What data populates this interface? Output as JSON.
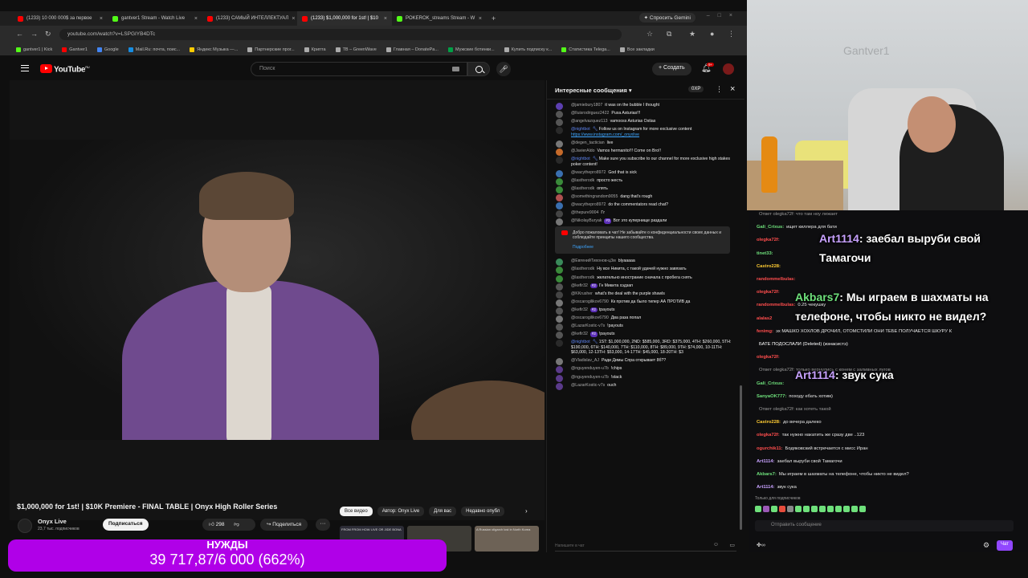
{
  "browser": {
    "tabs": [
      {
        "label": "(1233) 10 000 000$ за первое",
        "color": "#ff0000"
      },
      {
        "label": "gantver1 Stream - Watch Live",
        "color": "#53fc18"
      },
      {
        "label": "(1233) САМЫЙ ИНТЕЛЛЕКТУАЛ",
        "color": "#ff0000"
      },
      {
        "label": "(1233) $1,000,000 for 1st! | $10",
        "color": "#ff0000"
      },
      {
        "label": "POKEROK_streams Stream - W",
        "color": "#53fc18"
      }
    ],
    "gemini_label": "Спросить Gemini",
    "address": "youtube.com/watch?v=LSPGIYB4DTc",
    "bookmarks": [
      {
        "label": "gantver1 | Kick",
        "color": "#53fc18"
      },
      {
        "label": "Gantver1",
        "color": "#ff0000"
      },
      {
        "label": "Google",
        "color": "#4285f4"
      },
      {
        "label": "Mail.Ru: почта, поис...",
        "color": "#168de2"
      },
      {
        "label": "Яндекс Музыка —...",
        "color": "#ffcc00"
      },
      {
        "label": "Партнерские прог...",
        "color": "#aaaaaa"
      },
      {
        "label": "Крипта",
        "color": "#aaaaaa"
      },
      {
        "label": "TB – GreenWave",
        "color": "#aaaaaa"
      },
      {
        "label": "Главная – DonatePa...",
        "color": "#aaaaaa"
      },
      {
        "label": "Мужские ботинки...",
        "color": "#00a046"
      },
      {
        "label": "Купить подписку к...",
        "color": "#aaaaaa"
      },
      {
        "label": "Статистика Теlega...",
        "color": "#53fc18"
      },
      {
        "label": "Все закладки",
        "color": "#aaaaaa"
      }
    ]
  },
  "youtube": {
    "logo_text": "YouTube",
    "logo_region": "RU",
    "search_placeholder": "Поиск",
    "create_label": "+ Создать",
    "notifications_badge": "9+",
    "video_title": "$1,000,000 for 1st! | $10K Premiere - FINAL TABLE | Onyx High Roller Series",
    "channel_name": "Onyx Live",
    "channel_subs": "23,7 тыс. подписчиков",
    "subscribe_label": "Подписаться",
    "likes": "298",
    "share_label": "Поделиться",
    "chips": [
      "Все видео",
      "Автор: Onyx Live",
      "Для вас",
      "Недавно опубл"
    ],
    "thumb_captions": [
      "FROM FROM HOW LIVE OR JIDE BONA",
      "",
      "A Russian oligarch lost in North Korea"
    ]
  },
  "chat": {
    "header_title": "Интересные сообщения",
    "xp_label": "0XP",
    "input_placeholder": "Напишите в чат",
    "notice_text": "Добро пожаловать в чат! Не забывайте о конфиденциальности своих данных и соблюдайте принципы нашего сообщества.",
    "notice_more": "Подробнее",
    "messages": [
      {
        "author": "@jamiebury1807",
        "text": "it was on the bubble I thought",
        "color": "#5c3fb0"
      },
      {
        "author": "@lluisrodriguez2422",
        "text": "Puxa Asturias!!!",
        "color": "#555555"
      },
      {
        "author": "@angelvazquez113",
        "text": "vamooss Asturias Ostias",
        "color": "#555555"
      },
      {
        "author": "@nightbot",
        "text": "Follow us on Instagram for more exclusive content",
        "link": "https://www.instagram.com/_onyxlive",
        "mod": true,
        "color": "#2a2a2a"
      },
      {
        "author": "@degen_tactician",
        "text": "live",
        "color": "#777777"
      },
      {
        "author": "@JavierAldo",
        "text": "Vamos hermanito!!! Come on Bro!!",
        "color": "#c56a2a"
      },
      {
        "author": "@nightbot",
        "text": "Make sure you subscribe to our channel for more exclusive high stakes poker content!",
        "mod": true,
        "color": "#2a2a2a"
      },
      {
        "author": "@wacythepro8972",
        "text": "God that is sick",
        "color": "#3a6fb0"
      },
      {
        "author": "@lastherodk",
        "text": "просто жесть",
        "color": "#3a8a3a"
      },
      {
        "author": "@lastherodk",
        "text": "опять",
        "color": "#3a8a3a"
      },
      {
        "author": "@somethingrandom9055",
        "text": "dang that's rough",
        "color": "#b05050"
      },
      {
        "author": "@wacythepro8972",
        "text": "do the commentators read chat?",
        "color": "#3a6fb0"
      },
      {
        "author": "@thepure9004",
        "text": "Гг",
        "color": "#444444"
      },
      {
        "author": "@NikolayBuryak",
        "badge": "#3",
        "text": "Вот это купернище раздали",
        "color": "#777777"
      }
    ],
    "messages2": [
      {
        "author": "@ЕвгенийТихонов-ц3м",
        "text": "blyaaaaa",
        "color": "#3a8a5a"
      },
      {
        "author": "@lastherodk",
        "text": "Ну все Никита, с такой удачей нужно завязать",
        "color": "#3a8a3a"
      },
      {
        "author": "@lastherodk",
        "text": "желательно инострание сначала с пробега снять",
        "color": "#3a8a3a"
      },
      {
        "author": "@kefir32",
        "badge": "#2",
        "text": "Гн Микита хэдзап",
        "color": "#555555"
      },
      {
        "author": "@KKrusher",
        "text": "what's the deal with the purple shawls",
        "color": "#444444"
      },
      {
        "author": "@oscarogilikov6790",
        "text": "Кк против да было типер АА ПРОТИВ да",
        "color": "#777777"
      },
      {
        "author": "@kefir32",
        "badge": "#2",
        "text": "tpayouts",
        "color": "#555555"
      },
      {
        "author": "@oscarogilikov6790",
        "text": "Два раза попал",
        "color": "#777777"
      },
      {
        "author": "@LazarKostic-v7s",
        "text": "!payouts",
        "color": "#555555"
      },
      {
        "author": "@kefir32",
        "badge": "#2",
        "text": "!payouts",
        "color": "#555555"
      },
      {
        "author": "@nightbot",
        "text": "1ST: $1,000,000, 2ND: $585,000, 3RD: $375,000, 4TH: $260,000, 5TH: $190,000, 6TH: $140,000, 7TH: $110,000, 8TH: $89,000, 9TH: $74,000, 10-11TH: $63,000, 12-13TH: $53,000, 14-17TH: $45,000, 18-20TH: $3",
        "mod": true,
        "color": "#2a2a2a"
      },
      {
        "author": "@Vladislav_AJ",
        "text": "Ради Димы Спра открывает 8б??",
        "color": "#777777"
      },
      {
        "author": "@nguyenduyen-u7b",
        "text": "!chips",
        "color": "#5a3a8a"
      },
      {
        "author": "@nguyenduyen-u7b",
        "text": "!stack",
        "color": "#5a3a8a"
      },
      {
        "author": "@LazarKostic-v7s",
        "text": "ouch",
        "color": "#5a3a8a"
      }
    ]
  },
  "donation": {
    "label": "НУЖДЫ",
    "value": "39 717,87/6 000 (662%)",
    "progress_percent": 662
  },
  "webcam": {
    "watermark": "Gantver1"
  },
  "stream_chat": {
    "lines": [
      {
        "name": "",
        "text": "Ответ olegka72f: что там ноу лежает",
        "color": "#999999"
      },
      {
        "name": "Gali_Crixus:",
        "text": "ищет киллера для бати",
        "color": "#6ee07b"
      },
      {
        "name": "olegka72f:",
        "text": "",
        "color": "#ff4d4d"
      },
      {
        "name": "tinet33:",
        "text": "",
        "color": "#6ee07b"
      },
      {
        "name": "Castro228:",
        "text": "",
        "color": "#ffcc33"
      },
      {
        "name": "randommelbulas:",
        "text": "",
        "color": "#ff4d4d"
      },
      {
        "name": "olegka72f:",
        "text": "",
        "color": "#ff4d4d"
      },
      {
        "name": "randommelbulas:",
        "text": "0.25 чекушку",
        "color": "#ff4d4d"
      },
      {
        "name": "alalas2",
        "text": "",
        "color": "#ff4d4d"
      },
      {
        "name": "fenimg:",
        "text": "эх МАШКО ХОХЛОВ ДРОЧИЛ, ОТОМСТИЛИ ОНИ ТЕБЕ ПОЛУЧАЕТСЯ ШКУРУ К",
        "color": "#ff4d4d"
      },
      {
        "name": "",
        "text": "БАТЕ ПОДОСЛАЛИ (Deleted) (изнасистэ)",
        "color": "#ffffff"
      },
      {
        "name": "olegka72f:",
        "text": "",
        "color": "#ff4d4d"
      },
      {
        "name": "",
        "text": "Ответ olegka72f: только вернулись с конем с заливных лугов",
        "color": "#999999"
      },
      {
        "name": "Gali_Crixus:",
        "text": "",
        "color": "#6ee07b"
      },
      {
        "name": "SanyaOK777:",
        "text": "походу ебать хотим)",
        "color": "#6ee07b"
      },
      {
        "name": "",
        "text": "Ответ olegka72f: как хотеть такой",
        "color": "#999999"
      },
      {
        "name": "Castro228:",
        "text": "до вечера далеко",
        "color": "#ffcc33"
      },
      {
        "name": "olegka72f:",
        "text": "так нужно накатить же сразу две ..123",
        "color": "#ff4d4d"
      },
      {
        "name": "ogurchik11:",
        "text": "Бодяковский встречается с мисс Иран",
        "color": "#ff4d4d"
      },
      {
        "name": "Art1114:",
        "text": "заебал выруби свой Тамагочи",
        "color": "#c8a2ff"
      },
      {
        "name": "Akbars7:",
        "text": "Мы играем в шахматы на телефоне, чтобы никто не видел?",
        "color": "#6ee07b"
      },
      {
        "name": "Art1114:",
        "text": "звук сука",
        "color": "#c8a2ff"
      }
    ],
    "highlights": [
      {
        "name": "Art1114",
        "text": ": заебал выруби свой Тамагочи"
      },
      {
        "name": "Akbars7",
        "text": ": Мы играем в шахматы на телефоне, чтобы никто не видел?"
      },
      {
        "name": "Art1114",
        "text": ": звук сука"
      }
    ],
    "sub_only": "Только для подписчиков",
    "input_placeholder": "Отправить сообщение",
    "send_label": "Чат"
  }
}
